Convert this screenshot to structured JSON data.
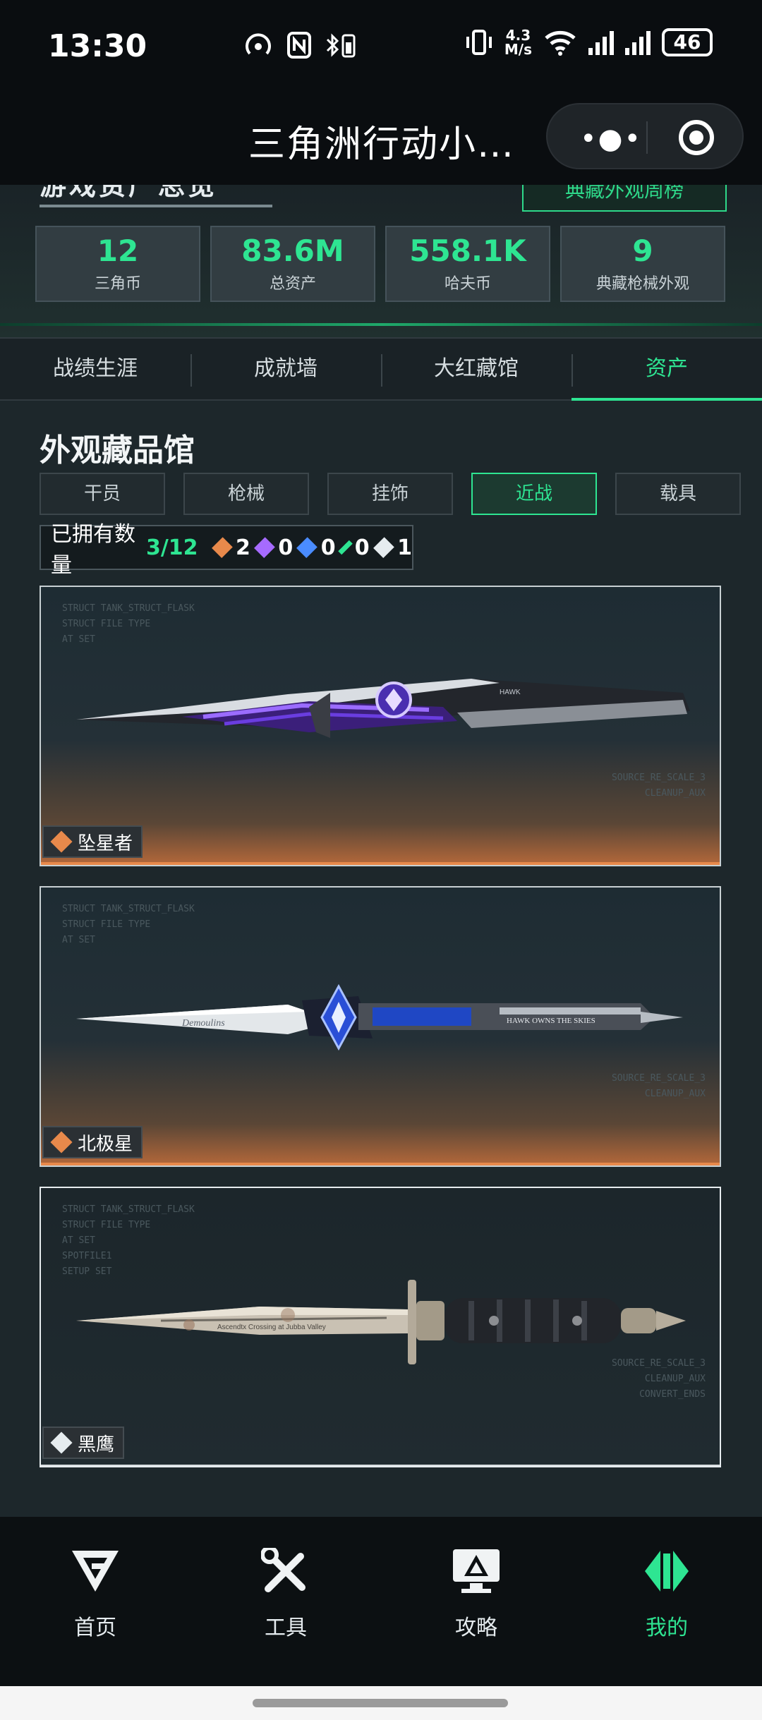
{
  "status_bar": {
    "time": "13:30",
    "speed_top": "4.3",
    "speed_bottom": "M/s",
    "battery": "46"
  },
  "header": {
    "title": "三角洲行动小…"
  },
  "overview": {
    "cut_title": "游戏资产总览",
    "weekly_button": "典藏外观周榜",
    "stats": [
      {
        "value": "12",
        "label": "三角币"
      },
      {
        "value": "83.6M",
        "label": "总资产"
      },
      {
        "value": "558.1K",
        "label": "哈夫币"
      },
      {
        "value": "9",
        "label": "典藏枪械外观"
      }
    ]
  },
  "tabs": [
    "战绩生涯",
    "成就墙",
    "大红藏馆",
    "资产"
  ],
  "active_tab": "资产",
  "section": {
    "title": "外观藏品馆",
    "subtabs": [
      "干员",
      "枪械",
      "挂饰",
      "近战",
      "载具"
    ],
    "active_subtab": "近战"
  },
  "ownership": {
    "label": "已拥有数量",
    "fraction": "3/12",
    "counts": [
      {
        "rarity": "orange",
        "color": "#e8894b",
        "value": "2"
      },
      {
        "rarity": "purple",
        "color": "#a66bff",
        "value": "0"
      },
      {
        "rarity": "blue",
        "color": "#4a8cff",
        "value": "0"
      },
      {
        "rarity": "green",
        "color": "#2ee592",
        "value": "0"
      },
      {
        "rarity": "white",
        "color": "#e6ecef",
        "value": "1"
      }
    ]
  },
  "items": [
    {
      "name": "坠星者",
      "rarity_color": "#e8894b",
      "knife_style": "purple-blade",
      "engraving": "HAWK"
    },
    {
      "name": "北极星",
      "rarity_color": "#e8894b",
      "knife_style": "blue-dagger",
      "engraving": "HAWK OWNS THE SKIES",
      "script": "Demoulins"
    },
    {
      "name": "黑鹰",
      "rarity_color": "#e6ecef",
      "knife_style": "combat-knife",
      "engraving": "Ascendtx Crossing at Jubba Valley"
    }
  ],
  "hud_text": {
    "lines": [
      "STRUCT TANK_STRUCT_FLASK",
      "STRUCT FILE TYPE",
      "AT SET",
      "",
      "SPOTFILE1",
      "",
      "SETUP SET"
    ],
    "right_lines": [
      "SOURCE_RE_SCALE_3",
      "CLEANUP_AUX",
      "CONVERT_ENDS"
    ]
  },
  "bottom_nav": [
    {
      "label": "首页",
      "icon": "home-logo-icon"
    },
    {
      "label": "工具",
      "icon": "tools-icon"
    },
    {
      "label": "攻略",
      "icon": "guide-monitor-icon"
    },
    {
      "label": "我的",
      "icon": "profile-logo-icon"
    }
  ],
  "active_nav": "我的",
  "colors": {
    "accent": "#2ee592",
    "rarity_orange": "#e8894b",
    "background": "#1d272b"
  }
}
